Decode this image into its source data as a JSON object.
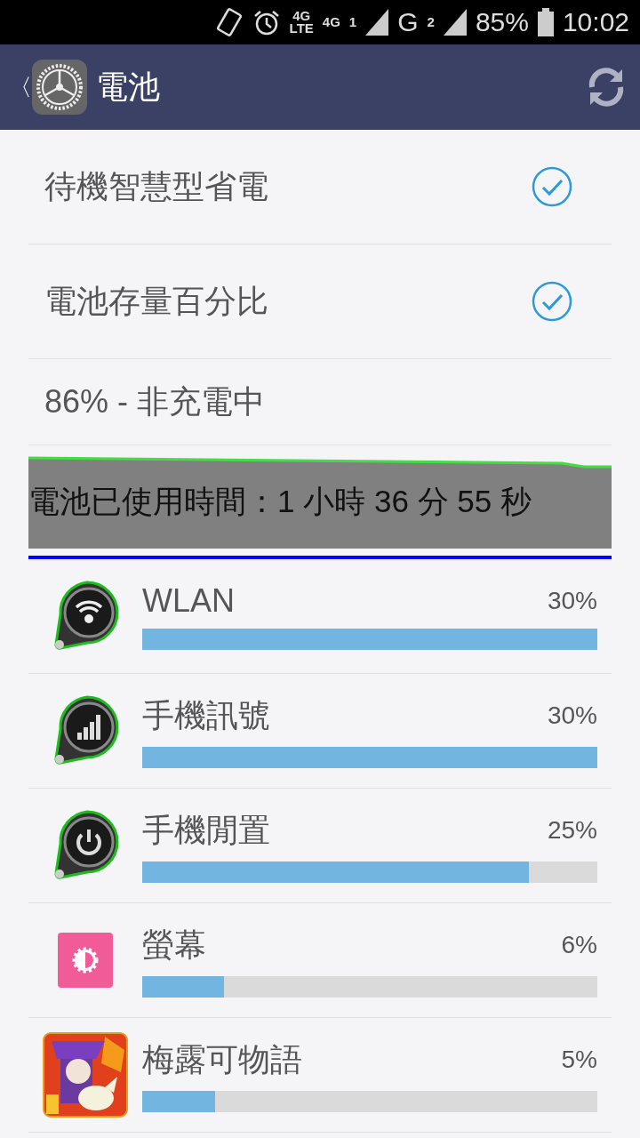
{
  "status_bar": {
    "network_1": "4G",
    "network_1_sub": "LTE",
    "network_2": "4G",
    "sim_1": "1",
    "network_3": "G",
    "sim_2": "2",
    "battery": "85%",
    "time": "10:02"
  },
  "header": {
    "back": "〈",
    "title": "電池"
  },
  "settings": [
    {
      "label": "待機智慧型省電",
      "checked": true
    },
    {
      "label": "電池存量百分比",
      "checked": true
    }
  ],
  "status_text": "86% - 非充電中",
  "usage_time": "電池已使用時間：1 小時 36 分 55 秒",
  "usage": [
    {
      "kind": "wifi",
      "name": "WLAN",
      "percent": "30%",
      "level": 1.0
    },
    {
      "kind": "signal",
      "name": "手機訊號",
      "percent": "30%",
      "level": 1.0
    },
    {
      "kind": "power",
      "name": "手機閒置",
      "percent": "25%",
      "level": 0.85
    },
    {
      "kind": "screen",
      "name": "螢幕",
      "percent": "6%",
      "level": 0.18
    },
    {
      "kind": "app",
      "name": "梅露可物語",
      "percent": "5%",
      "level": 0.16
    }
  ]
}
